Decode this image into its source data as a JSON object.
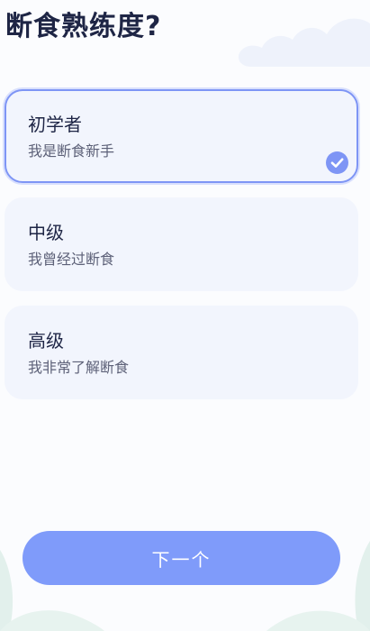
{
  "page": {
    "title": "断食熟练度?"
  },
  "options": [
    {
      "title": "初学者",
      "description": "我是断食新手",
      "selected": true
    },
    {
      "title": "中级",
      "description": "我曾经过断食",
      "selected": false
    },
    {
      "title": "高级",
      "description": "我非常了解断食",
      "selected": false
    }
  ],
  "next_button": {
    "label": "下一个"
  },
  "icons": {
    "selected_check": "checkmark-circle-icon",
    "background_cloud": "cloud-icon",
    "background_leaves": "leaf-icon"
  },
  "colors": {
    "accent": "#7e95f5",
    "button": "#7f9bfa",
    "card_background": "#f2f5fd",
    "title_text": "#1e2545",
    "secondary_text": "#5d6178"
  }
}
